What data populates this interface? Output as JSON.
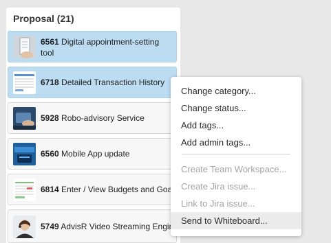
{
  "column": {
    "title": "Proposal (21)"
  },
  "cards": [
    {
      "id": "6561",
      "title": "Digital appointment-setting tool",
      "icon": "phone-app-thumbnail",
      "selected": true
    },
    {
      "id": "6718",
      "title": "Detailed Transaction History",
      "icon": "transaction-list-thumbnail",
      "selected": true
    },
    {
      "id": "5928",
      "title": "Robo-advisory Service",
      "icon": "tablet-hand-thumbnail",
      "selected": false
    },
    {
      "id": "6560",
      "title": "Mobile App update",
      "icon": "mobile-banking-thumbnail",
      "selected": false
    },
    {
      "id": "6814",
      "title": "Enter / View Budgets and Goal",
      "icon": "budget-table-thumbnail",
      "selected": false
    },
    {
      "id": "5749",
      "title": "AdvisR Video Streaming Engin",
      "icon": "person-headset-thumbnail",
      "selected": false
    }
  ],
  "context_menu": {
    "group1": [
      "Change category...",
      "Change status...",
      "Add tags...",
      "Add admin tags..."
    ],
    "group2": [
      "Create Team Workspace...",
      "Create Jira issue...",
      "Link to Jira issue..."
    ],
    "send_whiteboard": "Send to Whiteboard..."
  },
  "colors": {
    "selected_card": "#bcdcf2",
    "card": "#f7f7f7",
    "page_background": "#e8e8e8",
    "disabled_text": "#a3a3a3"
  }
}
